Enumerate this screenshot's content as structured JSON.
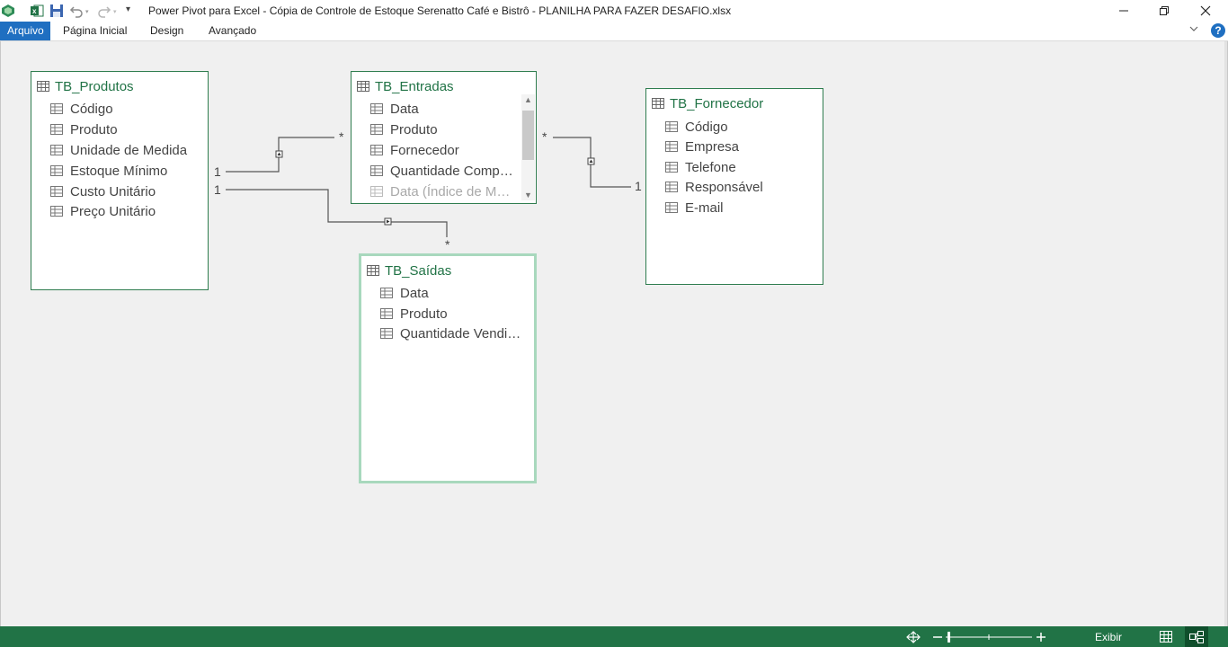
{
  "window": {
    "title": "Power Pivot para Excel - Cópia de Controle de Estoque Serenatto Café e Bistrô - PLANILHA PARA FAZER DESAFIO.xlsx"
  },
  "qat": {
    "icons": [
      "power-pivot-logo-icon",
      "excel-icon",
      "save-icon",
      "undo-icon",
      "redo-icon",
      "customize-qat-icon"
    ]
  },
  "ribbon": {
    "tabs": [
      {
        "label": "Arquivo",
        "active": true
      },
      {
        "label": "Página Inicial",
        "active": false
      },
      {
        "label": "Design",
        "active": false
      },
      {
        "label": "Avançado",
        "active": false
      }
    ],
    "help_label": "?"
  },
  "diagram": {
    "tables": [
      {
        "name": "TB_Produtos",
        "fields": [
          "Código",
          "Produto",
          "Unidade de Medida",
          "Estoque Mínimo",
          "Custo Unitário",
          "Preço Unitário"
        ]
      },
      {
        "name": "TB_Entradas",
        "fields": [
          "Data",
          "Produto",
          "Fornecedor",
          "Quantidade Comp…",
          "Data (Índice de M…"
        ]
      },
      {
        "name": "TB_Fornecedor",
        "fields": [
          "Código",
          "Empresa",
          "Telefone",
          "Responsável",
          "E-mail"
        ]
      },
      {
        "name": "TB_Saídas",
        "fields": [
          "Data",
          "Produto",
          "Quantidade Vendi…"
        ]
      }
    ],
    "relationships": [
      {
        "from": "TB_Produtos",
        "to": "TB_Entradas",
        "from_cardinality": "1",
        "to_cardinality": "*"
      },
      {
        "from": "TB_Produtos",
        "to": "TB_Saídas",
        "from_cardinality": "1",
        "to_cardinality": "*"
      },
      {
        "from": "TB_Fornecedor",
        "to": "TB_Entradas",
        "from_cardinality": "1",
        "to_cardinality": "*"
      }
    ]
  },
  "statusbar": {
    "view_label": "Exibir",
    "background": "#217346"
  },
  "colors": {
    "accent_green": "#217346",
    "active_tab_blue": "#1f6fc1"
  }
}
